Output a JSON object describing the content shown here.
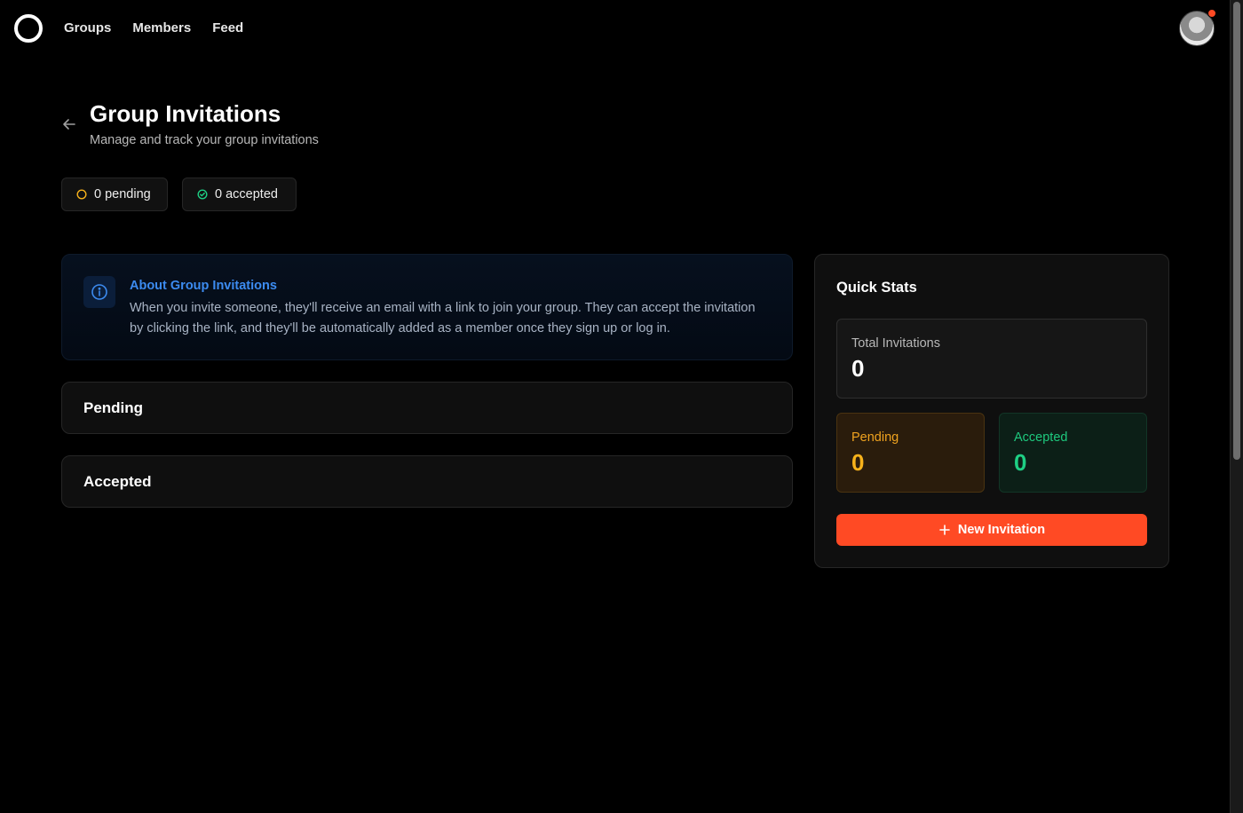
{
  "nav": {
    "items": [
      {
        "label": "Groups"
      },
      {
        "label": "Members"
      },
      {
        "label": "Feed"
      }
    ]
  },
  "header": {
    "title": "Group Invitations",
    "subtitle": "Manage and track your group invitations"
  },
  "summary": {
    "pending_label": "0 pending",
    "accepted_label": "0 accepted"
  },
  "info": {
    "title": "About Group Invitations",
    "text": "When you invite someone, they'll receive an email with a link to join your group. They can accept the invitation by clicking the link, and they'll be automatically added as a member once they sign up or log in."
  },
  "sections": {
    "pending": "Pending",
    "accepted": "Accepted"
  },
  "stats": {
    "title": "Quick Stats",
    "total_label": "Total Invitations",
    "total_value": "0",
    "pending_label": "Pending",
    "pending_value": "0",
    "accepted_label": "Accepted",
    "accepted_value": "0",
    "new_button": "New Invitation"
  },
  "colors": {
    "accent": "#ff4a24",
    "info_blue": "#3c8bf0",
    "pending": "#f7b21b",
    "accepted": "#1ecf84"
  },
  "icons": {
    "logo": "ring-logo-icon",
    "back": "arrow-left-icon",
    "pending": "circle-icon",
    "accepted": "check-circle-icon",
    "info": "info-icon",
    "add": "plus-icon"
  }
}
